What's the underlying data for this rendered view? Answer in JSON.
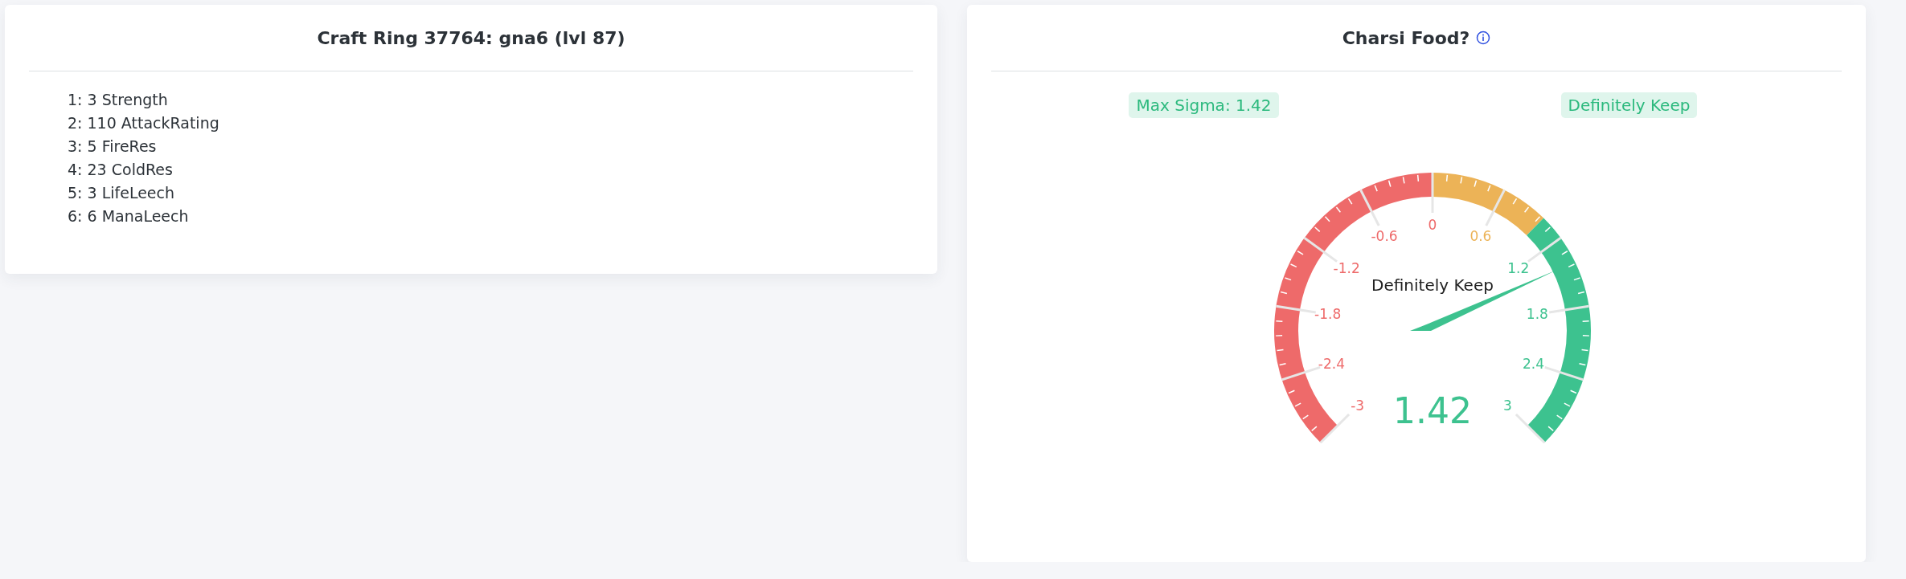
{
  "item_card": {
    "title": "Craft Ring 37764: gna6 (lvl 87)",
    "affixes": [
      "1: 3 Strength",
      "2: 110 AttackRating",
      "3: 5 FireRes",
      "4: 23 ColdRes",
      "5: 3 LifeLeech",
      "6: 6 ManaLeech"
    ]
  },
  "verdict_card": {
    "title": "Charsi Food?",
    "badges": [
      "Max Sigma: 1.42",
      "Definitely Keep"
    ],
    "gauge": {
      "title": "Definitely Keep",
      "value_text": "1.42",
      "ticks": [
        "-3",
        "-2.4",
        "-1.8",
        "-1.2",
        "-0.6",
        "0",
        "0.6",
        "1.2",
        "1.8",
        "2.4",
        "3"
      ],
      "bands": [
        {
          "color": "#ee6a6a"
        },
        {
          "color": "#ecb357"
        },
        {
          "color": "#3dc28f"
        }
      ]
    }
  }
}
